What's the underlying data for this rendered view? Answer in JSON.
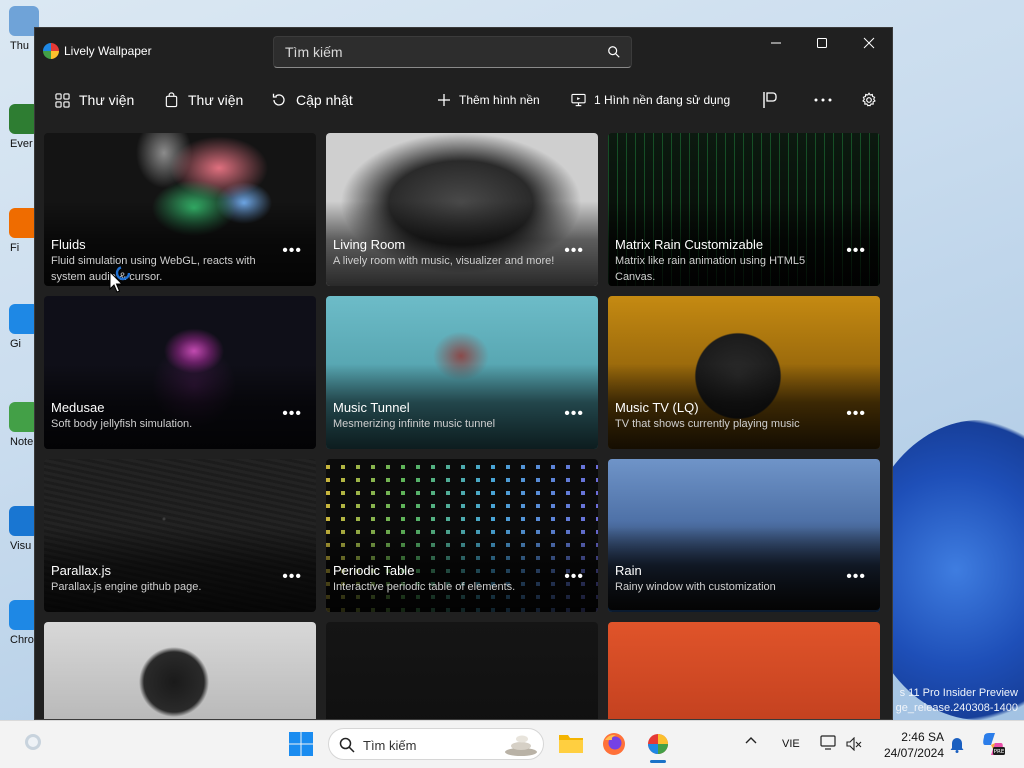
{
  "desktop": {
    "icons": [
      {
        "label": "Thu",
        "color": "#6fa3d8"
      },
      {
        "label": "Ever",
        "color": "#2e7d32"
      },
      {
        "label": "Fi",
        "color": "#ef6c00"
      },
      {
        "label": "Gi",
        "color": "#1e88e5"
      },
      {
        "label": "Note",
        "color": "#43a047"
      },
      {
        "label": "Visu\nC",
        "color": "#1976d2"
      },
      {
        "label": "Chro",
        "color": "#1e88e5"
      }
    ],
    "watermark_line1": "s 11 Pro Insider Preview",
    "watermark_line2": "ge_release.240308-1400"
  },
  "window": {
    "title": "Lively Wallpaper",
    "search_placeholder": "Tìm kiếm",
    "nav": {
      "library_label": "Thư viện",
      "gallery_label": "Thư viện",
      "update_label": "Cập nhật",
      "add_wallpaper_label": "Thêm hình nền",
      "active_wallpapers_label": "1 Hình nền đang sử dụng"
    },
    "accent": "#60cdff"
  },
  "cards": [
    {
      "title": "Fluids",
      "desc": "Fluid simulation using WebGL, reacts with system audio & cursor.",
      "bg": "fluids"
    },
    {
      "title": "Living Room",
      "desc": "A lively room with music, visualizer and more!",
      "bg": "room"
    },
    {
      "title": "Matrix Rain Customizable",
      "desc": "Matrix like rain animation using HTML5 Canvas.",
      "bg": "matrix"
    },
    {
      "title": "Medusae",
      "desc": "Soft body jellyfish simulation.",
      "bg": "medusae"
    },
    {
      "title": "Music Tunnel",
      "desc": "Mesmerizing infinite music tunnel",
      "bg": "tunnel"
    },
    {
      "title": "Music TV (LQ)",
      "desc": "TV that shows currently playing music",
      "bg": "tv"
    },
    {
      "title": "Parallax.js",
      "desc": "Parallax.js engine github page.",
      "bg": "parallax"
    },
    {
      "title": "Periodic Table",
      "desc": "Interactive periodic table of elements.",
      "bg": "periodic"
    },
    {
      "title": "Rain",
      "desc": "Rainy window with customization",
      "bg": "rain",
      "active": true
    },
    {
      "title": "",
      "desc": "",
      "bg": "pc"
    },
    {
      "title": "",
      "desc": "",
      "bg": "dark"
    },
    {
      "title": "",
      "desc": "",
      "bg": "orange"
    }
  ],
  "more_glyph": "•••",
  "taskbar": {
    "search_label": "Tìm kiếm",
    "language": "VIE",
    "time": "2:46 SA",
    "date": "24/07/2024"
  }
}
